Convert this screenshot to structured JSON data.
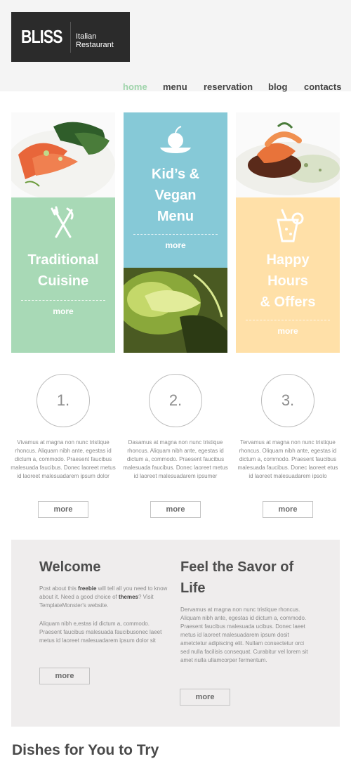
{
  "header": {
    "logo_name": "BLISS",
    "logo_tagline": "Italian Restaurant"
  },
  "nav": [
    {
      "label": "home",
      "active": true
    },
    {
      "label": "menu",
      "active": false
    },
    {
      "label": "reservation",
      "active": false
    },
    {
      "label": "blog",
      "active": false
    },
    {
      "label": "contacts",
      "active": false
    }
  ],
  "features": [
    {
      "title": "Traditional Cuisine",
      "title_lines": [
        "Traditional",
        "Cuisine"
      ],
      "more": "more",
      "color": "#a8d9b6",
      "icon": "fork-knife-icon"
    },
    {
      "title": "Kid's & Vegan Menu",
      "title_lines": [
        "Kid’s &",
        "Vegan",
        "Menu"
      ],
      "more": "more",
      "color": "#86c9d7",
      "icon": "apple-plate-icon"
    },
    {
      "title": "Happy Hours & Offers",
      "title_lines": [
        "Happy",
        "Hours",
        "& Offers"
      ],
      "more": "more",
      "color": "#ffe0a8",
      "icon": "cocktail-glass-icon"
    }
  ],
  "steps": [
    {
      "number": "1.",
      "text": "Vivamus at magna non nunc tristique rhoncus. Aliquam nibh ante, egestas id dictum a, commodo. Praesent faucibus malesuada faucibus. Donec laoreet metus id laoreet malesuadarem ipsum dolor",
      "more": "more"
    },
    {
      "number": "2.",
      "text": "Dasamus at magna non nunc tristique rhoncus. Aliquam nibh ante, egestas id dictum a, commodo. Praesent faucibus malesuada faucibus. Donec laoreet metus id laoreet malesuadarem ipsumer",
      "more": "more"
    },
    {
      "number": "3.",
      "text": "Tervamus at magna non nunc tristique rhoncus. Oliquam nibh ante, egestas id dictum a, commodo. Praesent faucibus malesuada faucibus. Donec laoreet etus id laoreet malesuadarem ipsolo",
      "more": "more"
    }
  ],
  "welcome": {
    "title": "Welcome",
    "para1_a": "Post about this ",
    "para1_b": "freebie",
    "para1_c": " will tell all you need to know about it. Need a good choice of ",
    "para1_d": "themes",
    "para1_e": "? Visit TemplateMonster's website.",
    "para2": "Aliquam nibh e,estas id dictum a, commodo. Praesent faucibus malesuada faucibusonec laeet metus id laoreet malesuadarem ipsum dolor sit",
    "more": "more"
  },
  "savor": {
    "title_line1": "Feel the Savor of",
    "title_line2": "Life",
    "para": "Dervamus at magna non nunc tristique rhoncus. Aliquam nibh ante, egestas id dictum a, commodo. Praesent faucibus malesuada ucibus. Donec laeet metus id laoreet malesuadarem ipsum dosit ametctetur adipiscing elit. Nullam consectetur orci sed nulla facilisis consequat. Curabitur vel lorem sit amet nulla ullamcorper fermentum.",
    "more": "more"
  },
  "dishes_title": "Dishes for You to Try"
}
